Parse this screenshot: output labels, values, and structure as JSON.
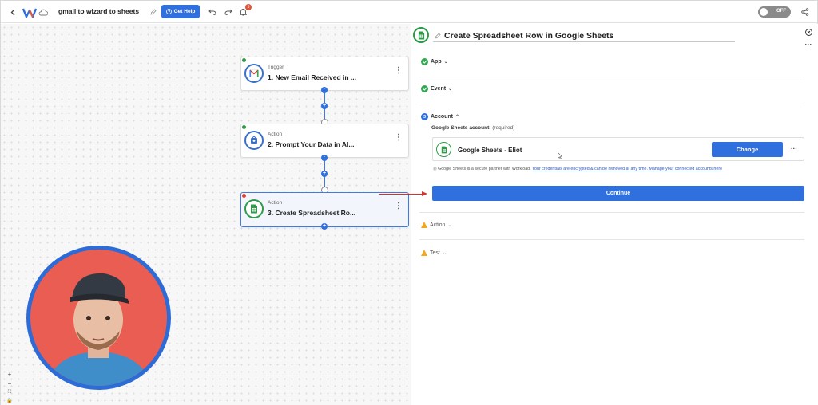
{
  "topbar": {
    "back_icon": "chevron-left-icon",
    "logo_icon": "workload-logo-icon",
    "cloud_icon": "cloud-icon",
    "zap_title": "gmail to wizard to sheets",
    "edit_icon": "pencil-icon",
    "help_label": "Get Help",
    "undo_icon": "undo-icon",
    "redo_icon": "redo-icon",
    "notification_count": "5",
    "toggle_label": "OFF",
    "share_icon": "share-icon",
    "accent_color": "#2f6fde"
  },
  "canvas": {
    "steps": [
      {
        "kind": "Trigger",
        "title": "1. New Email Received in ...",
        "icon": "gmail-icon",
        "dot_color": "#2e9b49"
      },
      {
        "kind": "Action",
        "title": "2. Prompt Your Data in AI...",
        "icon": "ai-wizard-icon",
        "dot_color": "#2e9b49"
      },
      {
        "kind": "Action",
        "title": "3. Create Spreadsheet Ro...",
        "icon": "google-sheets-icon",
        "dot_color": "#d9432f"
      }
    ],
    "zoom_controls": [
      "+",
      "−",
      "⛶",
      "🔒"
    ]
  },
  "panel": {
    "title": "Create Spreadsheet Row in Google Sheets",
    "sections": {
      "app": "App",
      "event": "Event",
      "account_number": "3",
      "account": "Account",
      "action": "Action",
      "test": "Test"
    },
    "account_label": "Google Sheets account:",
    "account_required": "(required)",
    "account_name": "Google Sheets - Eliot",
    "change_label": "Change",
    "more_label": "···",
    "partner_text": "Google Sheets is a secure partner with Workload.",
    "partner_link_1": "Your credentials are encrypted & can be removed at any time.",
    "partner_link_2": "Manage your connected accounts here",
    "continue_label": "Continue",
    "status_colors": {
      "complete": "#33a852",
      "warning": "#f2a91d",
      "annotation_arrow": "#d62f2f"
    }
  }
}
